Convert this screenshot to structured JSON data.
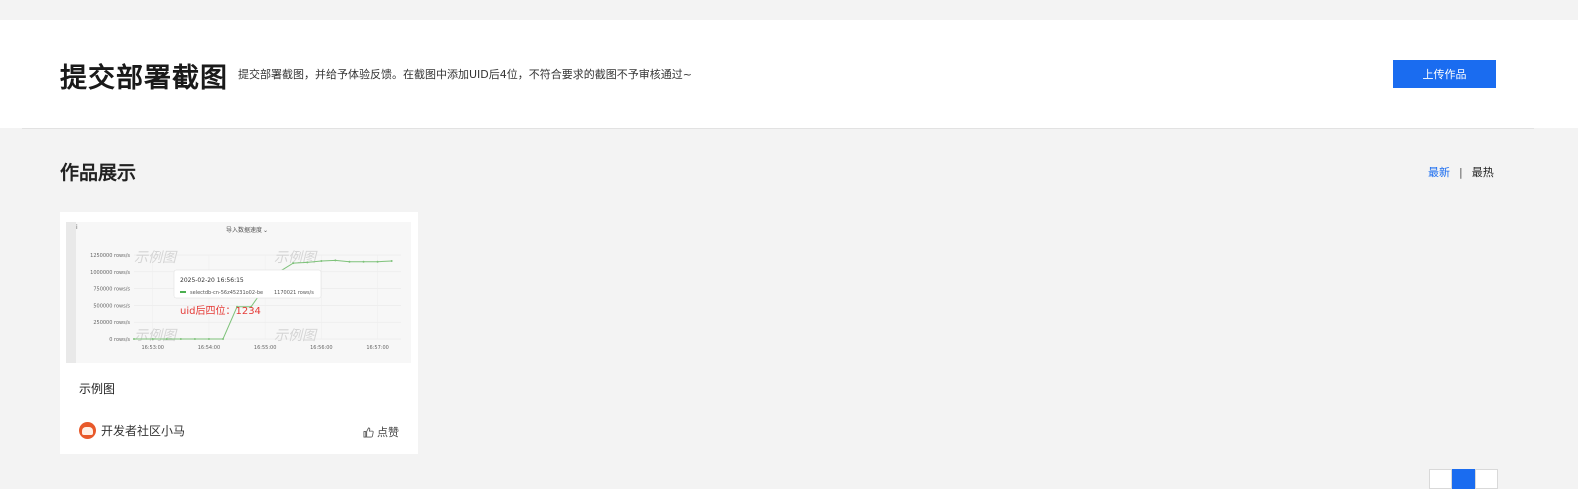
{
  "header": {
    "title": "提交部署截图",
    "description": "提交部署截图，并给予体验反馈。在截图中添加UID后4位，不符合要求的截图不予审核通过~",
    "upload_label": "上传作品"
  },
  "section": {
    "title": "作品展示",
    "sort_newest": "最新",
    "sort_separator": "|",
    "sort_hot": "最热"
  },
  "card": {
    "title": "示例图",
    "author": "开发者社区小马",
    "like_label": "点赞",
    "thumbnail": {
      "chart_title": "导入数据速度",
      "tooltip_time": "2025-02-20 16:56:15",
      "tooltip_series": "selectdb-cn-56z45231o02-be",
      "tooltip_value": "1170021 rows/s",
      "annotation": "uid后四位：1234",
      "watermark": "示例图",
      "chart_data": {
        "type": "line",
        "title": "导入数据速度",
        "y_ticks": [
          "1250000 rows/s",
          "1000000 rows/s",
          "750000 rows/s",
          "500000 rows/s",
          "250000 rows/s",
          "0 rows/s"
        ],
        "x_ticks": [
          "16:53:00",
          "16:54:00",
          "16:55:00",
          "16:56:00",
          "16:57:00"
        ],
        "ylim": [
          0,
          1250000
        ],
        "series": [
          {
            "name": "selectdb-cn-56z45231o02-be",
            "x": [
              "16:52:40",
              "16:53:00",
              "16:53:15",
              "16:53:30",
              "16:53:45",
              "16:54:00",
              "16:54:15",
              "16:54:30",
              "16:54:45",
              "16:55:00",
              "16:55:15",
              "16:55:30",
              "16:55:45",
              "16:56:00",
              "16:56:15",
              "16:56:30",
              "16:56:45",
              "16:57:00",
              "16:57:15"
            ],
            "values": [
              0,
              0,
              0,
              0,
              0,
              0,
              0,
              480000,
              480000,
              780000,
              1000000,
              1130000,
              1140000,
              1160000,
              1170021,
              1150000,
              1150000,
              1150000,
              1160000
            ]
          }
        ]
      }
    }
  },
  "colors": {
    "accent": "#1a6cf0",
    "series_line": "#7ec27a",
    "annotation": "#e53935"
  }
}
